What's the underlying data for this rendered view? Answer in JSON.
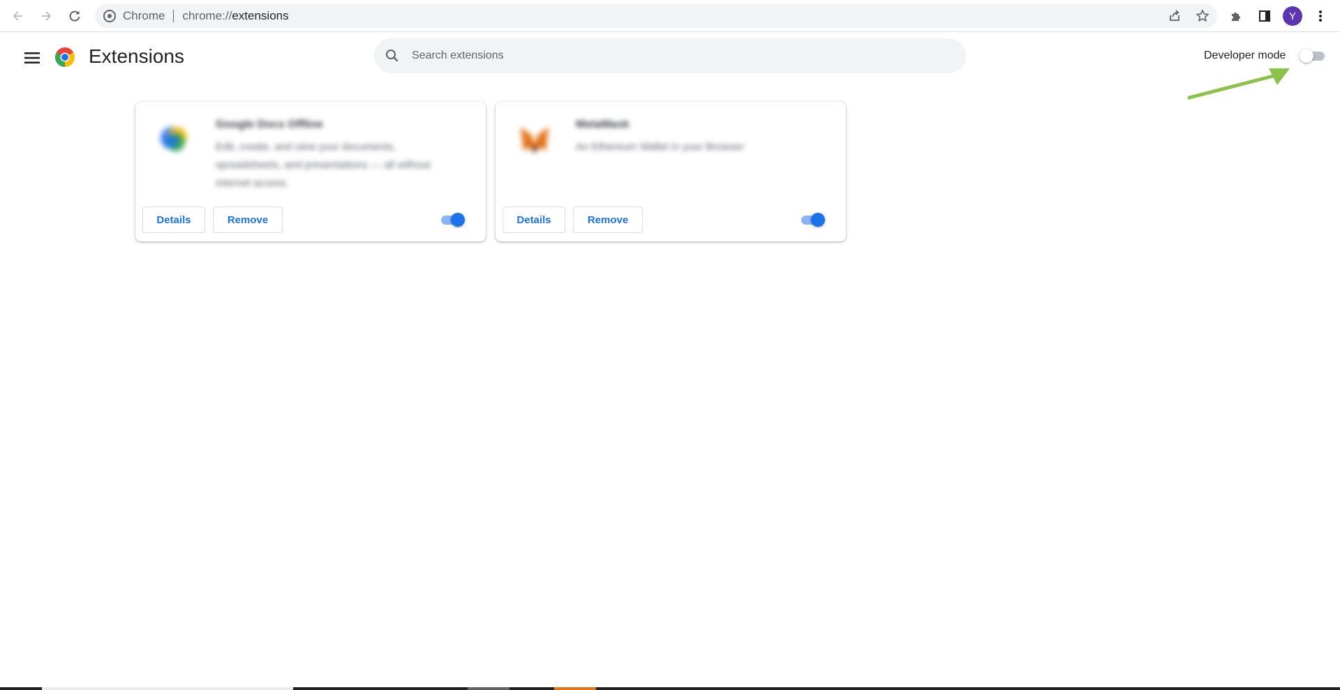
{
  "browser": {
    "site_label": "Chrome",
    "url_scheme": "chrome://",
    "url_path": "extensions",
    "profile_initial": "Y",
    "profile_color": "#5e35b1"
  },
  "header": {
    "title": "Extensions",
    "search_placeholder": "Search extensions",
    "developer_mode_label": "Developer mode",
    "developer_mode_on": false
  },
  "extensions": [
    {
      "name": "Google Docs Offline",
      "description": "Edit, create, and view your documents, spreadsheets, and presentations — all without internet access.",
      "details_label": "Details",
      "remove_label": "Remove",
      "enabled": true
    },
    {
      "name": "MetaMask",
      "description": "An Ethereum Wallet in your Browser",
      "details_label": "Details",
      "remove_label": "Remove",
      "enabled": true
    }
  ],
  "icons": {
    "back": "back-arrow-icon",
    "forward": "forward-arrow-icon",
    "reload": "reload-icon",
    "menu": "hamburger-menu-icon",
    "search": "search-icon",
    "share": "share-icon",
    "bookmark": "star-icon",
    "extensions": "puzzle-icon",
    "side_panel": "side-panel-icon",
    "more": "kebab-menu-icon"
  },
  "colors": {
    "accent": "#1a73e8",
    "annotation_arrow": "#8bc34a"
  }
}
